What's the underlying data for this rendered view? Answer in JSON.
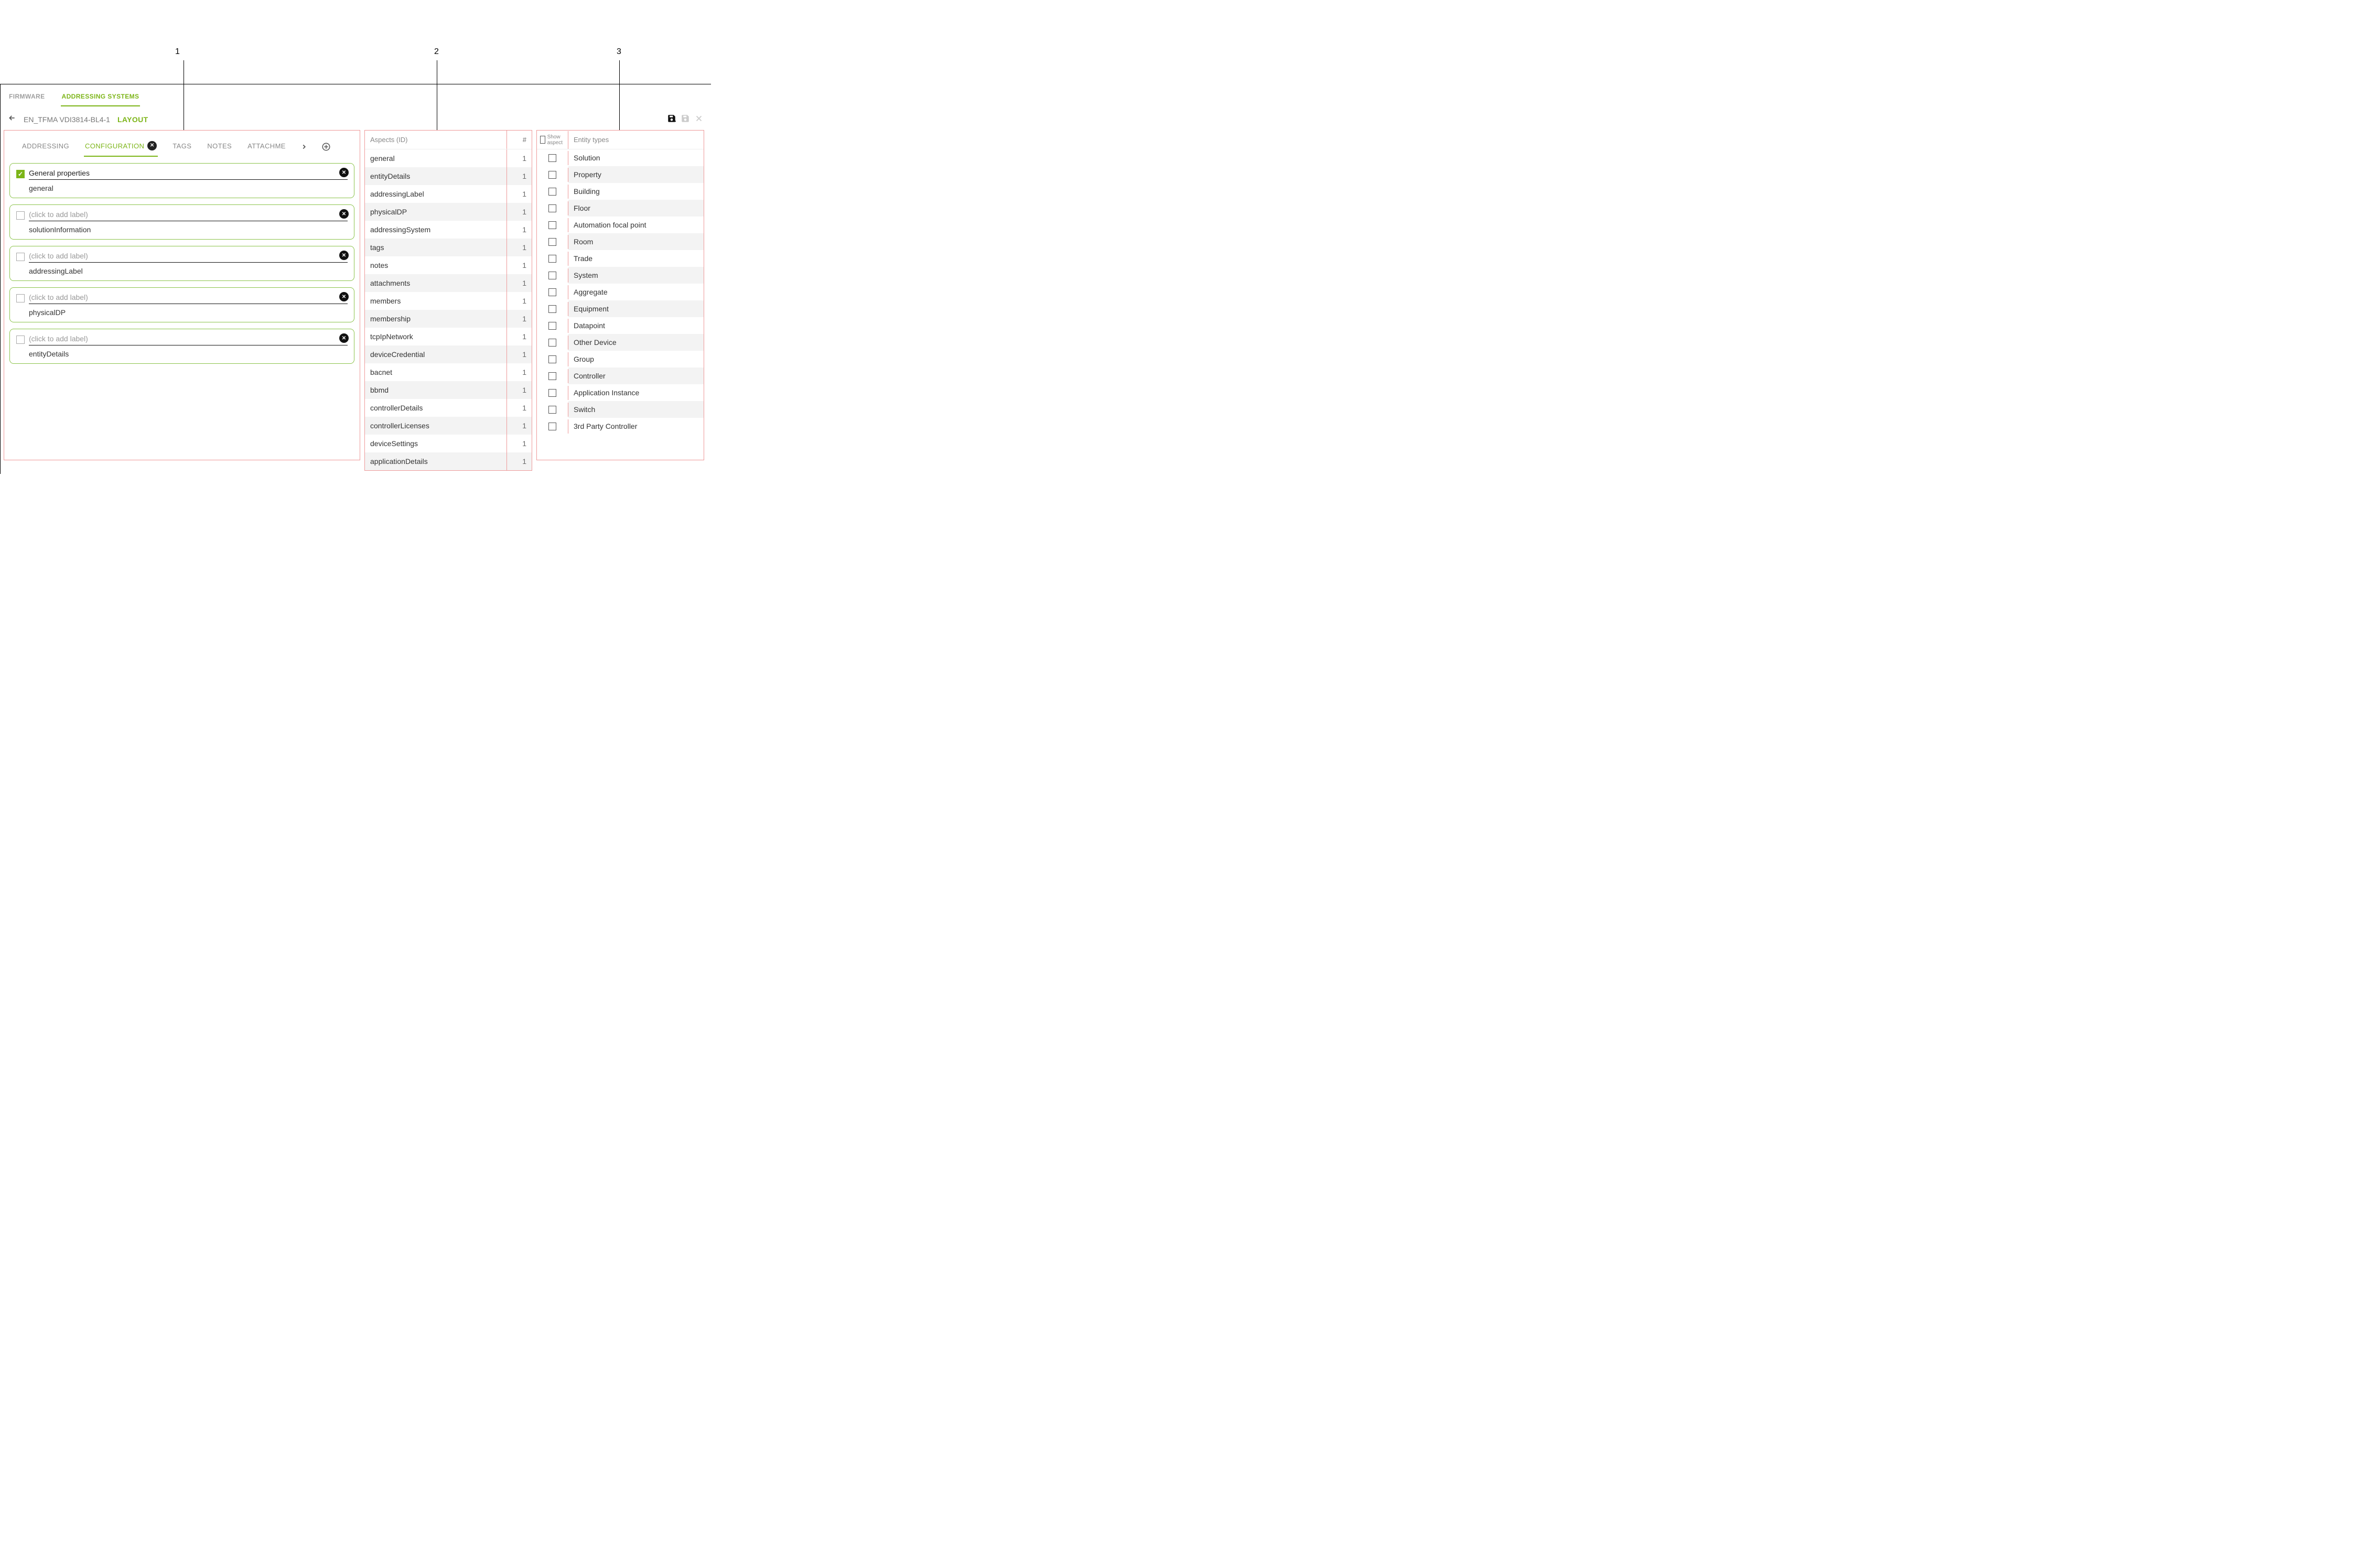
{
  "annotations": {
    "a1": "1",
    "a2": "2",
    "a3": "3"
  },
  "topTabs": {
    "firmware": "FIRMWARE",
    "addressing": "ADDRESSING SYSTEMS"
  },
  "breadcrumb": {
    "back": "←",
    "path": "EN_TFMA VDI3814-BL4-1",
    "layout": "LAYOUT"
  },
  "subtabs": {
    "addressing": "ADDRESSING",
    "configuration": "CONFIGURATION",
    "tags": "TAGS",
    "notes": "NOTES",
    "attachments": "ATTACHME"
  },
  "placeholder_click": "(click to add label)",
  "cards": [
    {
      "label": "General properties",
      "sub": "general",
      "checked": true,
      "has_label": true
    },
    {
      "label": "",
      "sub": "solutionInformation",
      "checked": false,
      "has_label": false
    },
    {
      "label": "",
      "sub": "addressingLabel",
      "checked": false,
      "has_label": false
    },
    {
      "label": "",
      "sub": "physicalDP",
      "checked": false,
      "has_label": false
    },
    {
      "label": "",
      "sub": "entityDetails",
      "checked": false,
      "has_label": false
    }
  ],
  "aspects": {
    "header_id": "Aspects (ID)",
    "header_count": "#",
    "rows": [
      {
        "id": "general",
        "count": "1"
      },
      {
        "id": "entityDetails",
        "count": "1"
      },
      {
        "id": "addressingLabel",
        "count": "1"
      },
      {
        "id": "physicalDP",
        "count": "1"
      },
      {
        "id": "addressingSystem",
        "count": "1"
      },
      {
        "id": "tags",
        "count": "1"
      },
      {
        "id": "notes",
        "count": "1"
      },
      {
        "id": "attachments",
        "count": "1"
      },
      {
        "id": "members",
        "count": "1"
      },
      {
        "id": "membership",
        "count": "1"
      },
      {
        "id": "tcpIpNetwork",
        "count": "1"
      },
      {
        "id": "deviceCredential",
        "count": "1"
      },
      {
        "id": "bacnet",
        "count": "1"
      },
      {
        "id": "bbmd",
        "count": "1"
      },
      {
        "id": "controllerDetails",
        "count": "1"
      },
      {
        "id": "controllerLicenses",
        "count": "1"
      },
      {
        "id": "deviceSettings",
        "count": "1"
      },
      {
        "id": "applicationDetails",
        "count": "1"
      }
    ]
  },
  "entities": {
    "header_show": "Show aspect",
    "header_types": "Entity types",
    "rows": [
      "Solution",
      "Property",
      "Building",
      "Floor",
      "Automation focal point",
      "Room",
      "Trade",
      "System",
      "Aggregate",
      "Equipment",
      "Datapoint",
      "Other Device",
      "Group",
      "Controller",
      "Application Instance",
      "Switch",
      "3rd Party Controller"
    ]
  }
}
